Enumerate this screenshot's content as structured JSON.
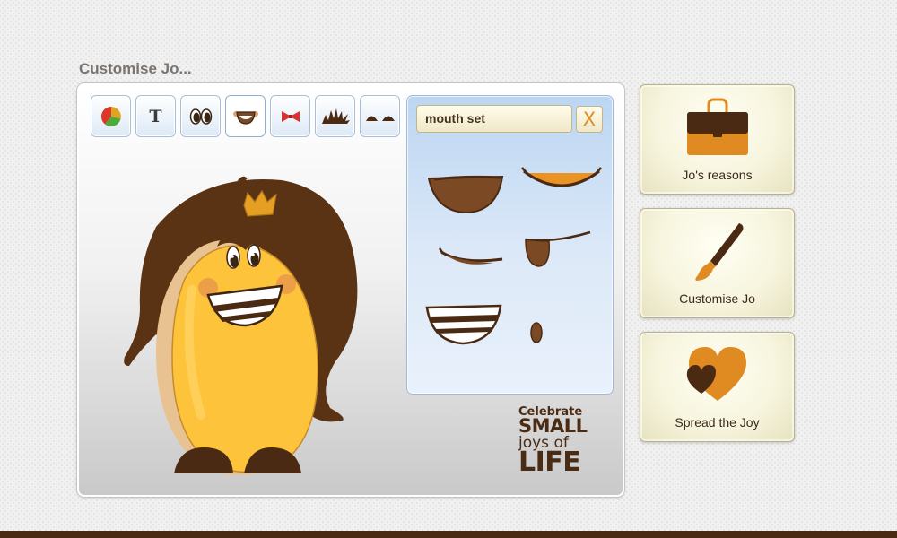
{
  "page": {
    "title": "Customise Jo..."
  },
  "toolbar": {
    "tools": [
      {
        "name": "color-tool",
        "icon": "color-wheel-icon"
      },
      {
        "name": "text-tool",
        "icon": "text-icon",
        "glyph": "T"
      },
      {
        "name": "eyes-tool",
        "icon": "eyes-icon"
      },
      {
        "name": "mouth-tool",
        "icon": "mouth-icon",
        "active": true
      },
      {
        "name": "accessory-tool",
        "icon": "bow-tie-icon"
      },
      {
        "name": "hair-tool",
        "icon": "hair-icon"
      },
      {
        "name": "eyebrows-tool",
        "icon": "eyebrows-icon"
      }
    ]
  },
  "mouth_panel": {
    "field_value": "mouth set",
    "close_label": "X",
    "options": [
      "wide-open-mouth",
      "smile-mouth",
      "smirk-mouth",
      "tongue-mouth",
      "teeth-grin-mouth",
      "small-o-mouth"
    ]
  },
  "tagline": {
    "line1": "Celebrate",
    "line2": "SMALL",
    "line3": "joys of",
    "line4": "LIFE"
  },
  "side_cards": [
    {
      "label": "Jo's reasons",
      "icon": "briefcase-icon"
    },
    {
      "label": "Customise Jo",
      "icon": "paintbrush-icon"
    },
    {
      "label": "Spread the Joy",
      "icon": "hearts-icon"
    }
  ],
  "colors": {
    "brand_brown": "#4a2a13",
    "accent_orange": "#df8b22",
    "character_yellow": "#fdc33a",
    "panel_blue": "#c7dcf3"
  }
}
